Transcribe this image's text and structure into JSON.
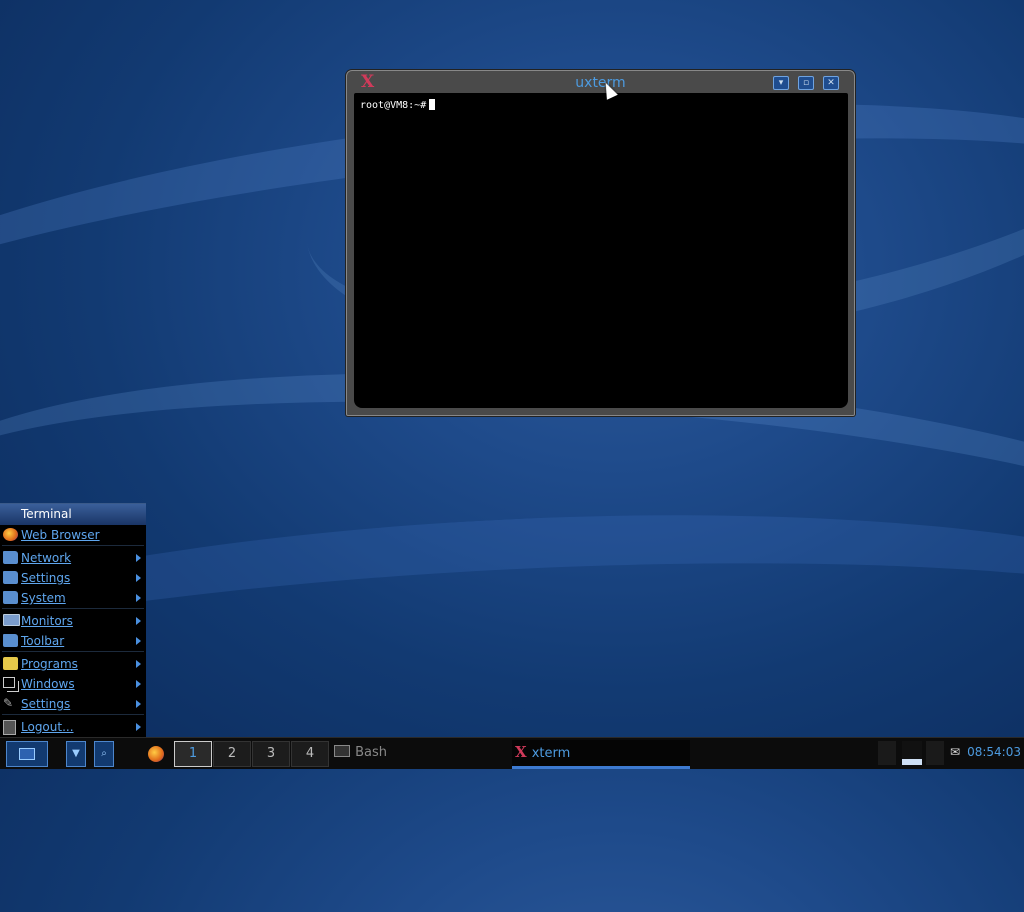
{
  "window": {
    "title": "uxterm",
    "icon": "x-icon",
    "prompt": "root@VM8:~#",
    "buttons": [
      "minimize-icon",
      "maximize-icon",
      "close-icon"
    ]
  },
  "menu": {
    "header": "Terminal",
    "items": [
      {
        "label": "Web Browser",
        "icon": "firefox-icon",
        "submenu": false
      },
      {
        "label": "Network",
        "icon": "folder-icon",
        "submenu": true
      },
      {
        "label": "Settings",
        "icon": "folder-icon",
        "submenu": true
      },
      {
        "label": "System",
        "icon": "folder-icon",
        "submenu": true
      },
      {
        "label": "Monitors",
        "icon": "monitor-icon",
        "submenu": true
      },
      {
        "label": "Toolbar",
        "icon": "folder-icon",
        "submenu": true
      },
      {
        "label": "Programs",
        "icon": "programs-icon",
        "submenu": true
      },
      {
        "label": "Windows",
        "icon": "windows-icon",
        "submenu": true
      },
      {
        "label": "Settings",
        "icon": "wrench-icon",
        "submenu": true
      },
      {
        "label": "Logout...",
        "icon": "logout-icon",
        "submenu": true
      }
    ]
  },
  "taskbar": {
    "workspaces": [
      "1",
      "2",
      "3",
      "4"
    ],
    "tasks": [
      {
        "label": "Bash",
        "icon": "terminal-icon"
      },
      {
        "label": "xterm",
        "icon": "x-icon",
        "active": true
      }
    ],
    "clock": "08:54:03"
  },
  "colors": {
    "accent": "#4d9be0",
    "menu_text": "#5fa6ee",
    "x_logo": "#d03a5a"
  }
}
